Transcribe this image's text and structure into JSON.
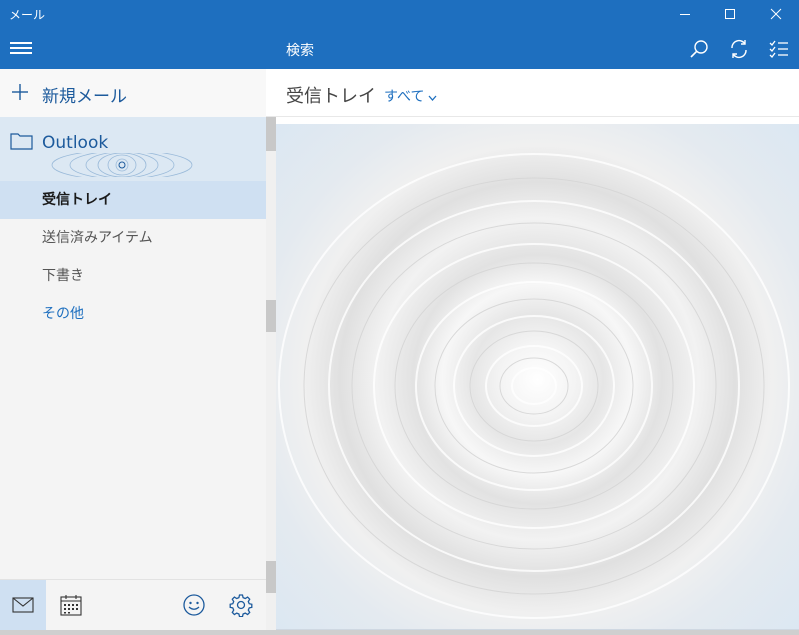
{
  "window": {
    "title": "メール"
  },
  "sidebar": {
    "new_mail_label": "新規メール",
    "account_name": "Outlook",
    "folders": [
      {
        "label": "受信トレイ",
        "active": true
      },
      {
        "label": "送信済みアイテム",
        "active": false
      },
      {
        "label": "下書き",
        "active": false
      },
      {
        "label": "その他",
        "active": false
      }
    ]
  },
  "toolbar": {
    "search_placeholder": "検索"
  },
  "list": {
    "folder_title": "受信トレイ",
    "filter_label": "すべて"
  },
  "icons": {
    "titlebar": [
      "minimize-icon",
      "maximize-icon",
      "close-icon"
    ],
    "toolbar": [
      "search-icon",
      "sync-icon",
      "selection-mode-icon"
    ],
    "bottom": [
      "mail-icon",
      "calendar-icon",
      "feedback-smile-icon",
      "settings-gear-icon"
    ]
  },
  "colors": {
    "accent": "#1e6fbf",
    "selected_bg": "#cfe0f2",
    "account_bg": "#dce8f3",
    "link_text": "#1c5a9c"
  }
}
